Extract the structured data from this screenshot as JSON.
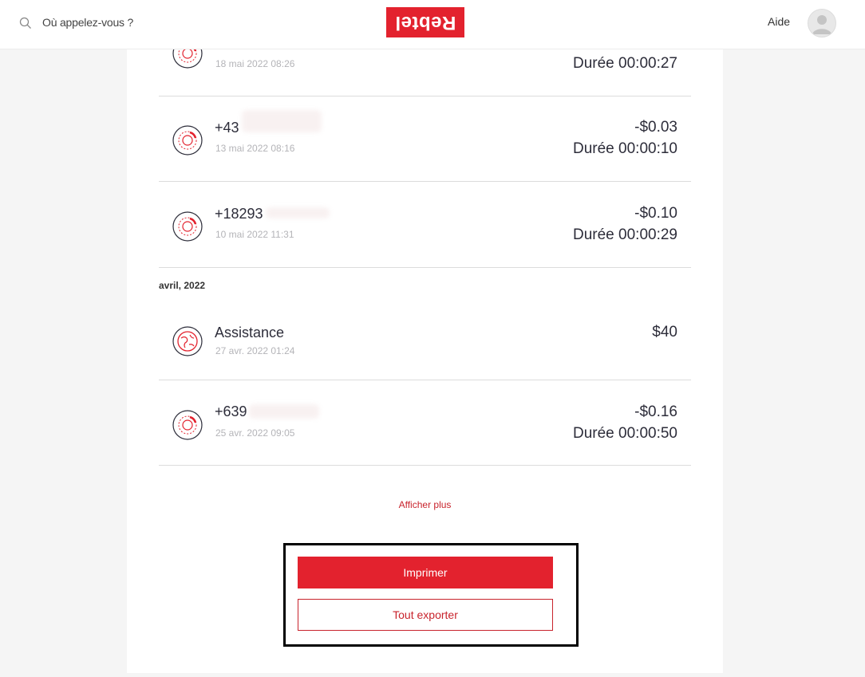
{
  "header": {
    "search_placeholder": "Où appelez-vous ?",
    "logo_text": "Rebtel",
    "help_label": "Aide"
  },
  "calls": [
    {
      "number": "",
      "date": "18 mai 2022 08:26",
      "amount": "",
      "duration": "Durée 00:00:27"
    },
    {
      "number": "+43",
      "date": "13 mai 2022 08:16",
      "amount": "-$0.03",
      "duration": "Durée 00:00:10"
    },
    {
      "number": "+18293",
      "date": "10 mai 2022 11:31",
      "amount": "-$0.10",
      "duration": "Durée 00:00:29"
    }
  ],
  "month_label": "avril, 2022",
  "april": [
    {
      "number": "Assistance",
      "date": "27 avr. 2022 01:24",
      "amount": "$40",
      "icon": "globe-icon"
    },
    {
      "number": "+639",
      "date": "25 avr. 2022 09:05",
      "amount": "-$0.16",
      "duration": "Durée 00:00:50",
      "icon": "call-globe-icon"
    }
  ],
  "show_more_label": "Afficher plus",
  "actions": {
    "print_label": "Imprimer",
    "export_label": "Tout exporter"
  },
  "colors": {
    "brand": "#e3222e",
    "link": "#c8232c"
  }
}
